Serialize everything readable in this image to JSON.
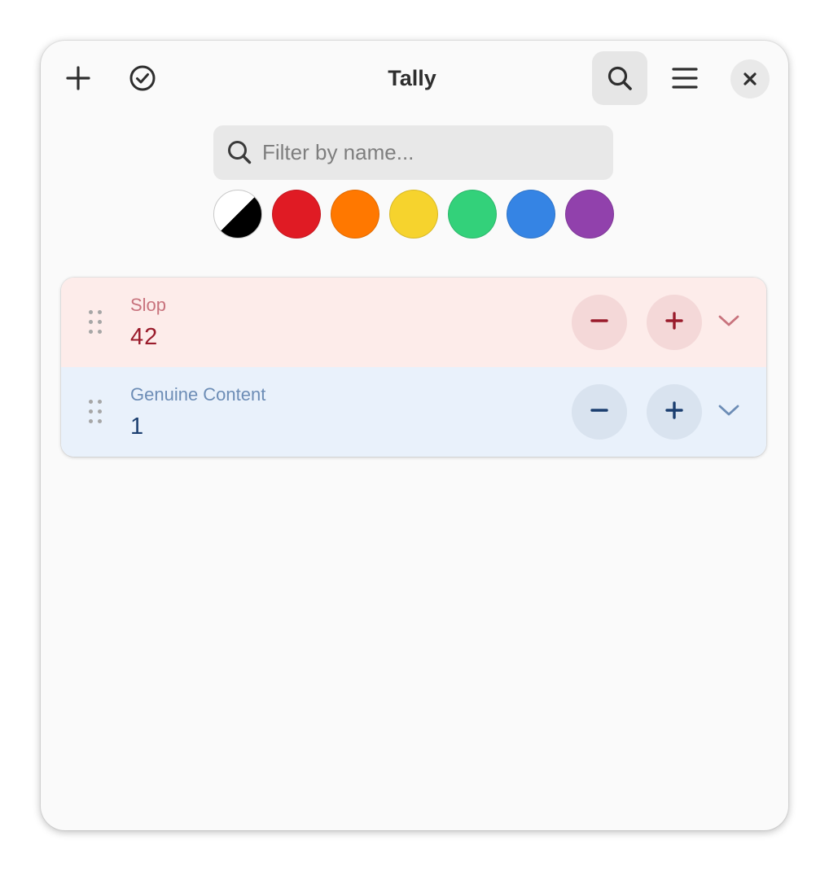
{
  "window": {
    "title": "Tally"
  },
  "header": {
    "add_icon": "plus-icon",
    "select_icon": "check-circle-icon",
    "search_icon": "search-icon",
    "menu_icon": "hamburger-menu-icon",
    "close_icon": "close-icon",
    "search_active": true
  },
  "search": {
    "placeholder": "Filter by name...",
    "value": ""
  },
  "color_filters": [
    {
      "name": "all",
      "color": "#000000"
    },
    {
      "name": "red",
      "color": "#e01b24"
    },
    {
      "name": "orange",
      "color": "#ff7800"
    },
    {
      "name": "yellow",
      "color": "#f6d32d"
    },
    {
      "name": "green",
      "color": "#33d17a"
    },
    {
      "name": "blue",
      "color": "#3584e4"
    },
    {
      "name": "purple",
      "color": "#9141ac"
    }
  ],
  "counters": [
    {
      "name": "Slop",
      "value": "42",
      "color": "red",
      "accent": "#9a1c2c",
      "background": "#fdecea"
    },
    {
      "name": "Genuine Content",
      "value": "1",
      "color": "blue",
      "accent": "#1c3f70",
      "background": "#e9f1fb"
    }
  ]
}
